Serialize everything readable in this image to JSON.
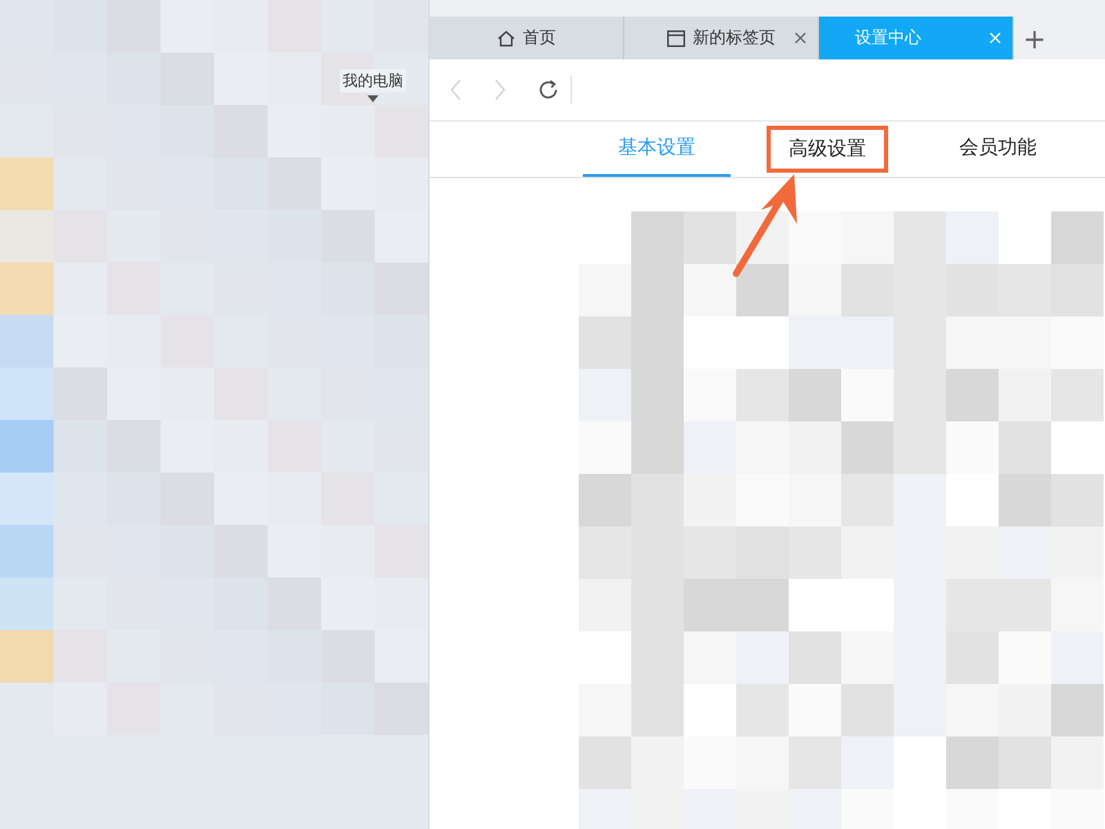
{
  "left_pane": {
    "label": "我的电脑"
  },
  "browser_tabs": [
    {
      "kind": "home",
      "label": "首页",
      "selected": false,
      "closable": false
    },
    {
      "kind": "page",
      "label": "新的标签页",
      "selected": false,
      "closable": true
    },
    {
      "kind": "plain",
      "label": "设置中心",
      "selected": true,
      "closable": true
    }
  ],
  "new_tab": "+",
  "nav": {
    "back_disabled": true,
    "forward_disabled": true
  },
  "settings_tabs": [
    {
      "label": "基本设置",
      "selected": true,
      "highlighted": false
    },
    {
      "label": "高级设置",
      "selected": false,
      "highlighted": true
    },
    {
      "label": "会员功能",
      "selected": false,
      "highlighted": false
    }
  ]
}
